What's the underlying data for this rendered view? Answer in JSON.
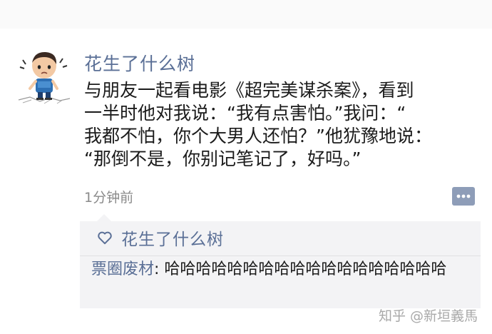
{
  "post": {
    "username": "花生了什么树",
    "text": "与朋友一起看电影《超完美谋杀案》，看到\n一半时他对我说：“我有点害怕。”我问：“\n我都不怕，你个大男人还怕？”他犹豫地说：\n“那倒不是，你别记笔记了，好吗。”",
    "timestamp": "1分钟前",
    "avatar_icon": "cartoon-kid-avatar",
    "comment_icon": "comment-bubble-icon"
  },
  "interactions": {
    "like_icon": "heart-outline-icon",
    "liked_by": "花生了什么树",
    "comment": {
      "author": "票圈废材",
      "separator": ": ",
      "text": "哈哈哈哈哈哈哈哈哈哈哈哈哈哈哈哈哈哈"
    }
  },
  "watermark": "知乎 @新垣義馬",
  "colors": {
    "name_blue": "#5a6f96",
    "text": "#1b1b1b",
    "muted": "#8a8a8a",
    "comment_bg": "#f3f3f5"
  }
}
